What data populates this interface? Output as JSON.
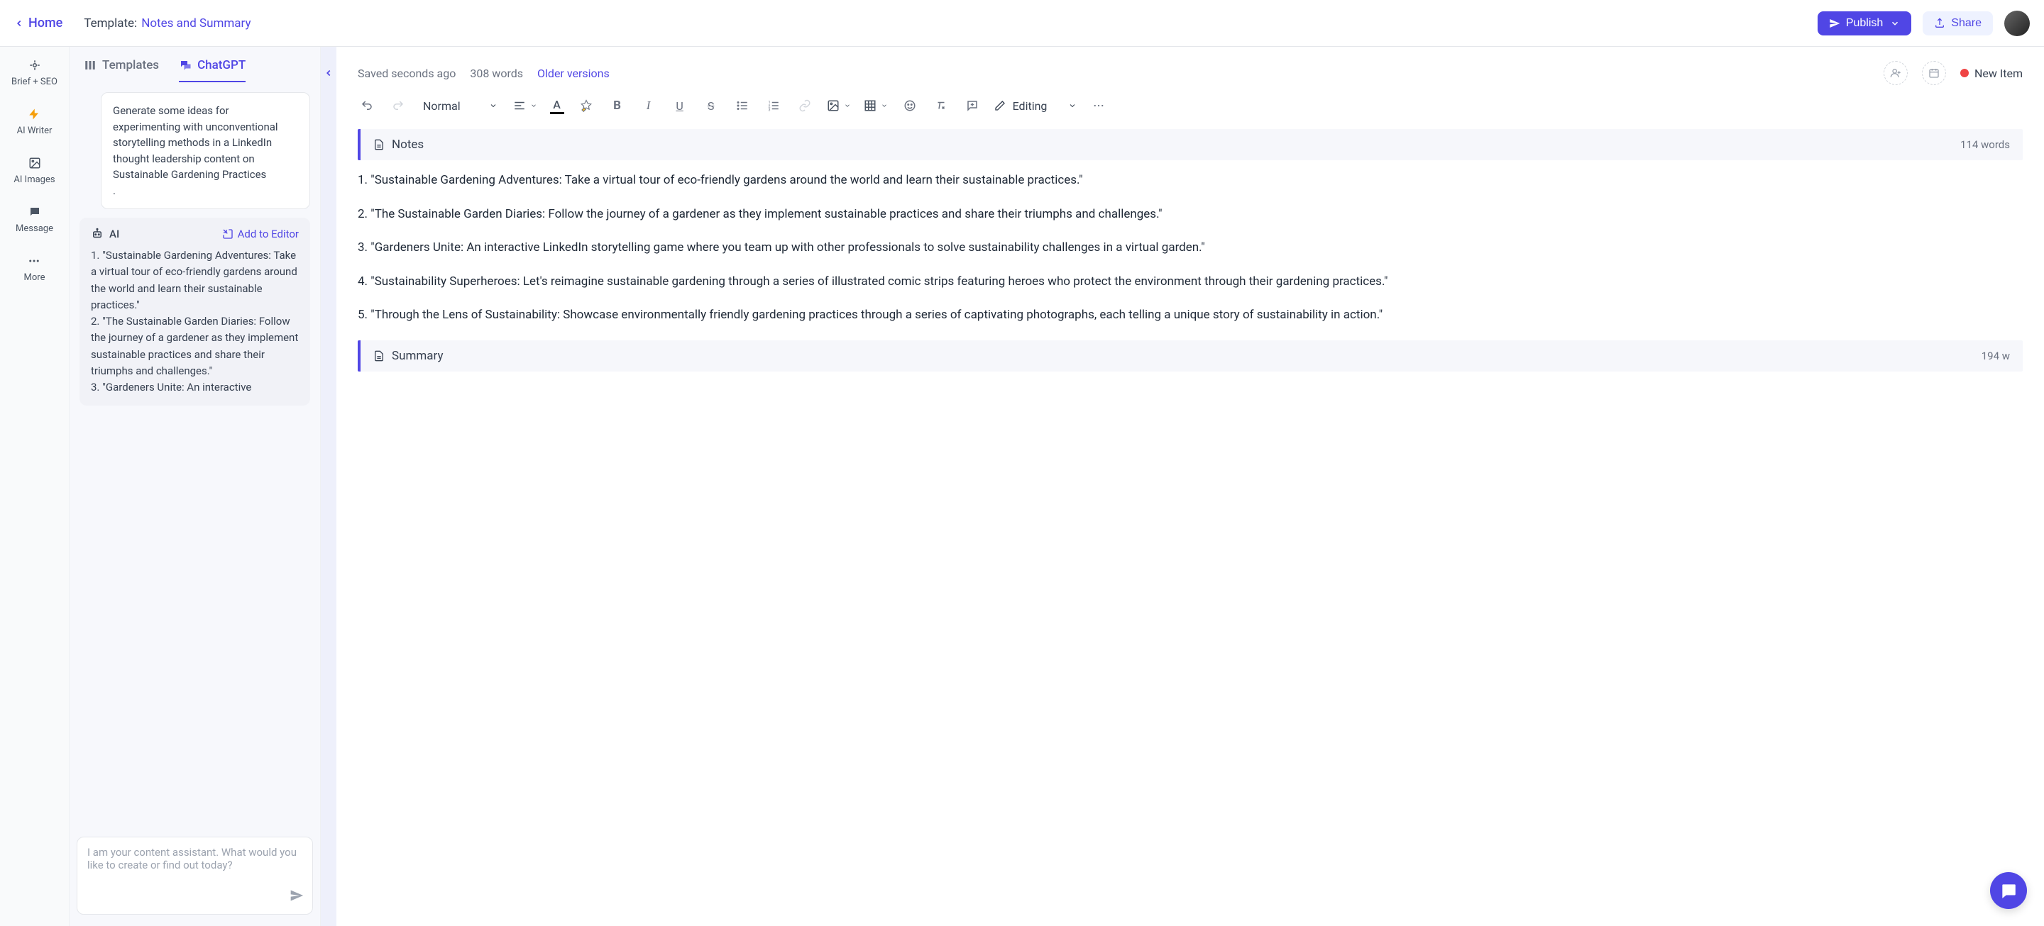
{
  "header": {
    "home": "Home",
    "template_label": "Template:",
    "template_name": "Notes and Summary",
    "publish": "Publish",
    "share": "Share"
  },
  "rail": {
    "items": [
      {
        "label": "Brief + SEO"
      },
      {
        "label": "AI Writer"
      },
      {
        "label": "AI Images"
      },
      {
        "label": "Message"
      },
      {
        "label": "More"
      }
    ]
  },
  "side": {
    "tabs": {
      "templates": "Templates",
      "chatgpt": "ChatGPT"
    },
    "user_message": "Generate some ideas for experimenting with unconventional storytelling methods in a LinkedIn thought leadership content on Sustainable Gardening Practices\n.",
    "ai_label": "AI",
    "add_to_editor": "Add to Editor",
    "ai_response": "1. \"Sustainable Gardening Adventures: Take a virtual tour of eco-friendly gardens around the world and learn their sustainable practices.\"\n2. \"The Sustainable Garden Diaries: Follow the journey of a gardener as they implement sustainable practices and share their triumphs and challenges.\"\n3. \"Gardeners Unite: An interactive",
    "input_placeholder": "I am your content assistant. What would you like to create or find out today?"
  },
  "editor_meta": {
    "saved": "Saved seconds ago",
    "words": "308 words",
    "older": "Older versions",
    "new_item": "New Item"
  },
  "toolbar": {
    "style": "Normal",
    "mode": "Editing"
  },
  "doc": {
    "notes": {
      "title": "Notes",
      "count": "114 words",
      "paras": [
        "1. \"Sustainable Gardening Adventures: Take a virtual tour of eco-friendly gardens around the world and learn their sustainable practices.\"",
        "2. \"The Sustainable Garden Diaries: Follow the journey of a gardener as they implement sustainable practices and share their triumphs and challenges.\"",
        "3. \"Gardeners Unite: An interactive LinkedIn storytelling game where you team up with other professionals to solve sustainability challenges in a virtual garden.\"",
        "4. \"Sustainability Superheroes: Let's reimagine sustainable gardening through a series of illustrated comic strips featuring heroes who protect the environment through their gardening practices.\"",
        "5. \"Through the Lens of Sustainability: Showcase environmentally friendly gardening practices through a series of captivating photographs, each telling a unique story of sustainability in action.\""
      ]
    },
    "summary": {
      "title": "Summary",
      "count": "194 w"
    }
  }
}
